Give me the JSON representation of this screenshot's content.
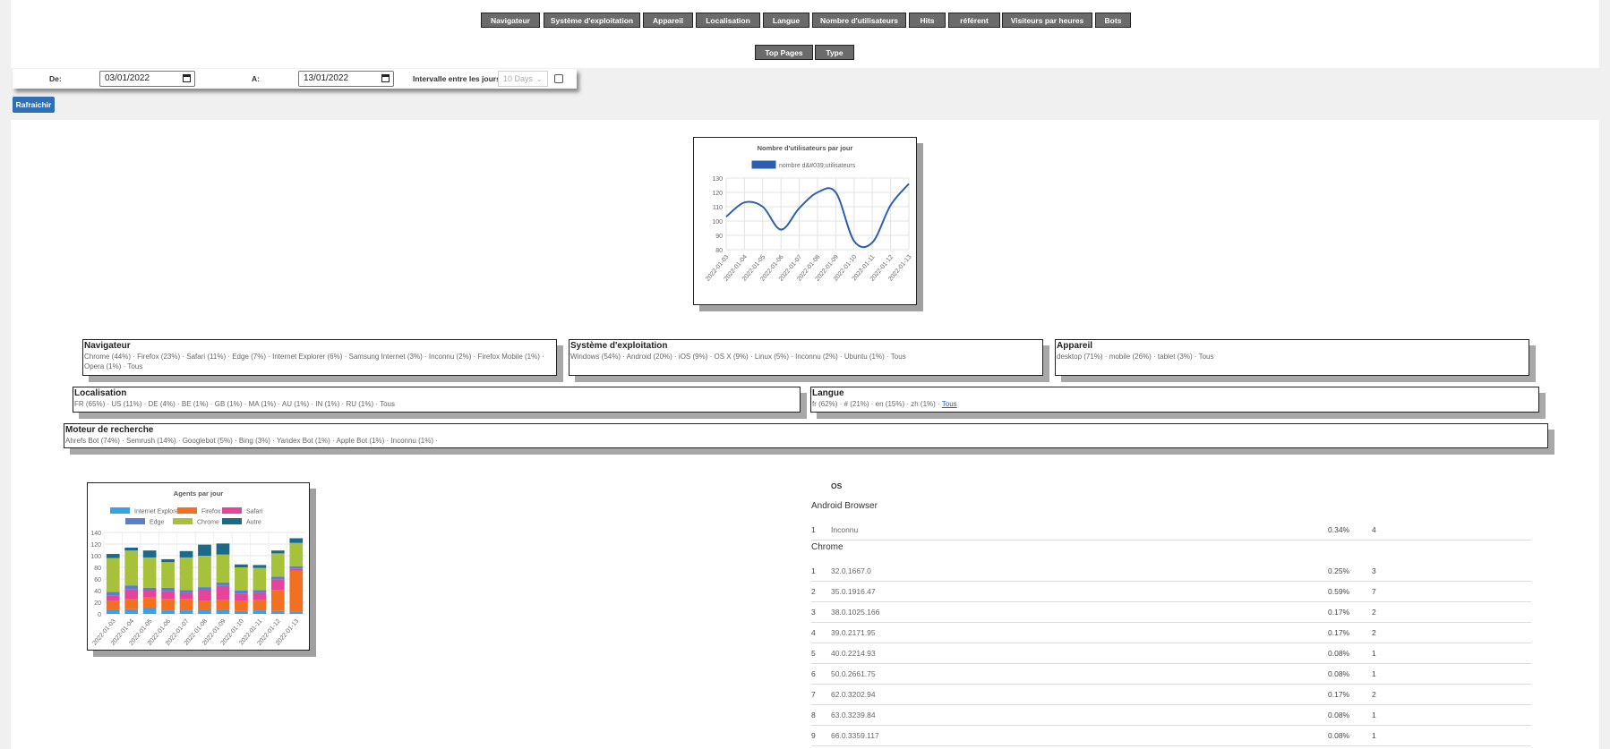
{
  "nav": {
    "buttons": [
      "Navigateur",
      "Système d'exploitation",
      "Appareil",
      "Localisation",
      "Langue",
      "Nombre d'utilisateurs",
      "Hits",
      "référent",
      "Visiteurs par heures",
      "Bots"
    ],
    "buttons2": [
      "Top Pages",
      "Type"
    ]
  },
  "filters": {
    "from_label": "De:",
    "from_value": "03/01/2022",
    "to_label": "A:",
    "to_value": "13/01/2022",
    "interval_label": "Intervalle entre les jours",
    "interval_value": "10 Days",
    "refresh_label": "Rafraichir"
  },
  "users_chart": {
    "title": "Nombre d'utilisateurs par jour",
    "legend": "nombre d&#039;utilisateurs",
    "color": "#2c5fb0"
  },
  "chart_data": [
    {
      "type": "line",
      "title": "Nombre d'utilisateurs par jour",
      "x": [
        "2022-01-03",
        "2022-01-04",
        "2022-01-05",
        "2022-01-06",
        "2022-01-07",
        "2022-01-08",
        "2022-01-09",
        "2022-01-10",
        "2022-01-11",
        "2022-01-12",
        "2022-01-13"
      ],
      "series": [
        {
          "name": "nombre d&#039;utilisateurs",
          "values": [
            103,
            113,
            110,
            94,
            109,
            120,
            120,
            86,
            85,
            111,
            126
          ]
        }
      ],
      "ylim": [
        80,
        130
      ],
      "yticks": [
        80,
        90,
        100,
        110,
        120,
        130
      ],
      "grid": true,
      "legend": "top"
    },
    {
      "type": "bar",
      "stacked": true,
      "title": "Agents par jour",
      "categories": [
        "2022-01-03",
        "2022-01-04",
        "2022-01-05",
        "2022-01-06",
        "2022-01-07",
        "2022-01-08",
        "2022-01-09",
        "2022-01-10",
        "2022-01-11",
        "2022-01-12",
        "2022-01-13"
      ],
      "series": [
        {
          "name": "Internet Explorer",
          "color": "#36a2eb",
          "values": [
            7,
            8,
            10,
            6,
            6,
            7,
            7,
            5,
            6,
            5,
            4
          ]
        },
        {
          "name": "Firefox",
          "color": "#f37021",
          "values": [
            15,
            17,
            18,
            20,
            20,
            16,
            17,
            18,
            18,
            36,
            70
          ]
        },
        {
          "name": "Safari",
          "color": "#e8439a",
          "values": [
            10,
            17,
            12,
            13,
            10,
            17,
            24,
            12,
            12,
            18,
            4
          ]
        },
        {
          "name": "Edge",
          "color": "#5b7fcf",
          "values": [
            6,
            7,
            5,
            6,
            5,
            6,
            6,
            5,
            5,
            5,
            4
          ]
        },
        {
          "name": "Chrome",
          "color": "#a7c13a",
          "values": [
            58,
            60,
            52,
            44,
            56,
            54,
            48,
            40,
            38,
            40,
            40
          ]
        },
        {
          "name": "Autre",
          "color": "#1a6a8c",
          "values": [
            7,
            5,
            12,
            5,
            11,
            19,
            19,
            5,
            5,
            5,
            8
          ]
        }
      ],
      "ylim": [
        0,
        140
      ],
      "yticks": [
        0,
        20,
        40,
        60,
        80,
        100,
        120,
        140
      ],
      "legend": "top"
    }
  ],
  "panels": [
    {
      "title": "Navigateur",
      "text": "Chrome (44%) · Firefox (23%) · Safari (11%) · Edge (7%) · Internet Explorer (6%) · Samsung Internet (3%) · Inconnu (2%) · Firefox Mobile (1%) · Opera (1%) · Tous"
    },
    {
      "title": "Système d'exploitation",
      "text": "Windows (54%) · Android (20%) · iOS (9%) · OS X (9%) · Linux (5%) · Inconnu (2%) · Ubuntu (1%) · Tous"
    },
    {
      "title": "Appareil",
      "text": "desktop (71%) · mobile (26%) · tablet (3%) · Tous"
    },
    {
      "title": "Localisation",
      "text": "FR (65%) · US (11%) · DE (4%) · BE (1%) · GB (1%) · MA (1%) · AU (1%) · IN (1%) · RU (1%) · Tous"
    },
    {
      "title": "Langue",
      "text": "fr (62%) · # (21%) · en (15%) · zh (1%) · ",
      "link": "Tous"
    },
    {
      "title": "Moteur de recherche",
      "text": "Ahrefs Bot (74%) · Semrush (14%) · Googlebot (5%) · Bing (3%) · Yandex Bot (1%) · Apple Bot (1%) · Inconnu (1%) ·"
    }
  ],
  "agents_chart": {
    "title": "Agents par jour"
  },
  "os_table": {
    "header": "OS",
    "groups": [
      {
        "name": "Android Browser",
        "rows": [
          {
            "n": "1",
            "version": "Inconnu",
            "pct": "0.34%",
            "count": "4"
          }
        ]
      },
      {
        "name": "Chrome",
        "rows": [
          {
            "n": "1",
            "version": "32.0.1667.0",
            "pct": "0.25%",
            "count": "3"
          },
          {
            "n": "2",
            "version": "35.0.1916.47",
            "pct": "0.59%",
            "count": "7"
          },
          {
            "n": "3",
            "version": "38.0.1025.166",
            "pct": "0.17%",
            "count": "2"
          },
          {
            "n": "4",
            "version": "39.0.2171.95",
            "pct": "0.17%",
            "count": "2"
          },
          {
            "n": "5",
            "version": "40.0.2214.93",
            "pct": "0.08%",
            "count": "1"
          },
          {
            "n": "6",
            "version": "50.0.2661.75",
            "pct": "0.08%",
            "count": "1"
          },
          {
            "n": "7",
            "version": "62.0.3202.94",
            "pct": "0.17%",
            "count": "2"
          },
          {
            "n": "8",
            "version": "63.0.3239.84",
            "pct": "0.08%",
            "count": "1"
          },
          {
            "n": "9",
            "version": "66.0.3359.117",
            "pct": "0.08%",
            "count": "1"
          }
        ]
      }
    ]
  }
}
